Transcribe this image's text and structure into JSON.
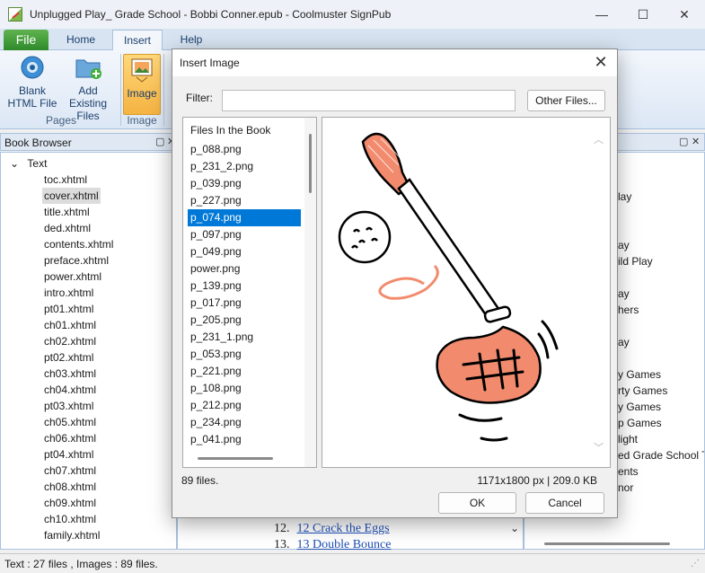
{
  "window": {
    "title": "Unplugged Play_ Grade School - Bobbi Conner.epub - Coolmuster SignPub",
    "minimize": "—",
    "maximize": "☐",
    "close": "✕"
  },
  "ribbon": {
    "tabs": {
      "file": "File",
      "home": "Home",
      "insert": "Insert",
      "help": "Help"
    },
    "blank_line1": "Blank",
    "blank_line2": "HTML File",
    "add_line1": "Add",
    "add_line2": "Existing Files",
    "image": "Image",
    "group_pages": "Pages",
    "group_image": "Image"
  },
  "book_browser": {
    "title": "Book Browser",
    "root": "Text",
    "items": [
      "toc.xhtml",
      "cover.xhtml",
      "title.xhtml",
      "ded.xhtml",
      "contents.xhtml",
      "preface.xhtml",
      "power.xhtml",
      "intro.xhtml",
      "pt01.xhtml",
      "ch01.xhtml",
      "ch02.xhtml",
      "pt02.xhtml",
      "ch03.xhtml",
      "ch04.xhtml",
      "pt03.xhtml",
      "ch05.xhtml",
      "ch06.xhtml",
      "pt04.xhtml",
      "ch07.xhtml",
      "ch08.xhtml",
      "ch09.xhtml",
      "ch10.xhtml",
      "family.xhtml"
    ]
  },
  "right_panel": {
    "items": [
      "lay",
      "ay",
      "ild Play",
      "ay",
      "hers",
      "ay",
      "y Games",
      "rty Games",
      "y Games",
      "p Games",
      "light",
      "ed Grade School T",
      "ents",
      "nor"
    ]
  },
  "toc": [
    {
      "num": "12.",
      "text": "12 Crack the Eggs"
    },
    {
      "num": "13.",
      "text": "13 Double Bounce"
    }
  ],
  "status": "Text : 27 files , Images : 89 files.",
  "dialog": {
    "title": "Insert Image",
    "close": "✕",
    "filter_label": "Filter:",
    "filter_value": "",
    "other_files": "Other Files...",
    "list_header": "Files In the Book",
    "files": [
      "p_088.png",
      "p_231_2.png",
      "p_039.png",
      "p_227.png",
      "p_074.png",
      "p_097.png",
      "p_049.png",
      "power.png",
      "p_139.png",
      "p_017.png",
      "p_205.png",
      "p_231_1.png",
      "p_053.png",
      "p_221.png",
      "p_108.png",
      "p_212.png",
      "p_234.png",
      "p_041.png"
    ],
    "selected_file": "p_074.png",
    "file_count": "89 files.",
    "image_info": "1171x1800 px | 209.0 KB",
    "ok": "OK",
    "cancel": "Cancel"
  },
  "colors": {
    "accent": "#0078d7",
    "ribbon": "#dce7f5",
    "club": "#f28b6e",
    "file_tab": "#3f9e38"
  }
}
